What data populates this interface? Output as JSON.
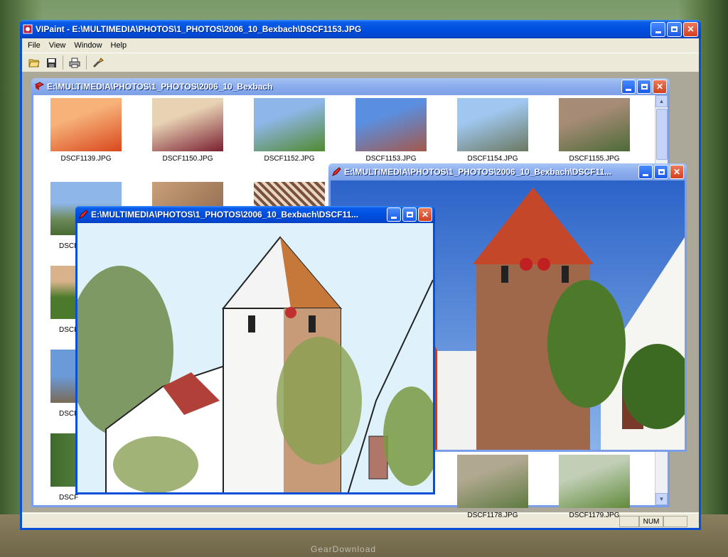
{
  "main_window": {
    "title": "VIPaint - E:\\MULTIMEDIA\\PHOTOS\\1_PHOTOS\\2006_10_Bexbach\\DSCF1153.JPG",
    "menu": [
      "File",
      "View",
      "Window",
      "Help"
    ],
    "toolbar": [
      "open-folder-icon",
      "save-icon",
      "print-icon",
      "tools-icon"
    ],
    "status": {
      "num": "NUM"
    }
  },
  "browser_window": {
    "title": "E:\\MULTIMEDIA\\PHOTOS\\1_PHOTOS\\2006_10_Bexbach",
    "thumbnails": [
      {
        "name": "DSCF1139.JPG",
        "colors": [
          "#f7b27a",
          "#d9481c"
        ]
      },
      {
        "name": "DSCF1150.JPG",
        "colors": [
          "#e8d2b4",
          "#7a2030"
        ]
      },
      {
        "name": "DSCF1152.JPG",
        "colors": [
          "#8fb6e8",
          "#4f8a2e"
        ]
      },
      {
        "name": "DSCF1153.JPG",
        "colors": [
          "#5a8fe0",
          "#a4584a"
        ]
      },
      {
        "name": "DSCF1154.JPG",
        "colors": [
          "#9fc7ef",
          "#6b7860"
        ]
      },
      {
        "name": "DSCF1155.JPG",
        "colors": [
          "#a68b76",
          "#4d6b38"
        ]
      },
      {
        "name": "DSCF1178.JPG",
        "colors": [
          "#b0a890",
          "#5e7a40"
        ]
      },
      {
        "name": "DSCF1179.JPG",
        "colors": [
          "#c2cfb7",
          "#5f8a3a"
        ]
      }
    ],
    "partial_labels": [
      "DSCF",
      "DSCF",
      "DSCF",
      "DSCF"
    ]
  },
  "photo_window": {
    "title": "E:\\MULTIMEDIA\\PHOTOS\\1_PHOTOS\\2006_10_Bexbach\\DSCF11..."
  },
  "sketch_window": {
    "title": "E:\\MULTIMEDIA\\PHOTOS\\1_PHOTOS\\2006_10_Bexbach\\DSCF11..."
  },
  "watermark": "GearDownload"
}
